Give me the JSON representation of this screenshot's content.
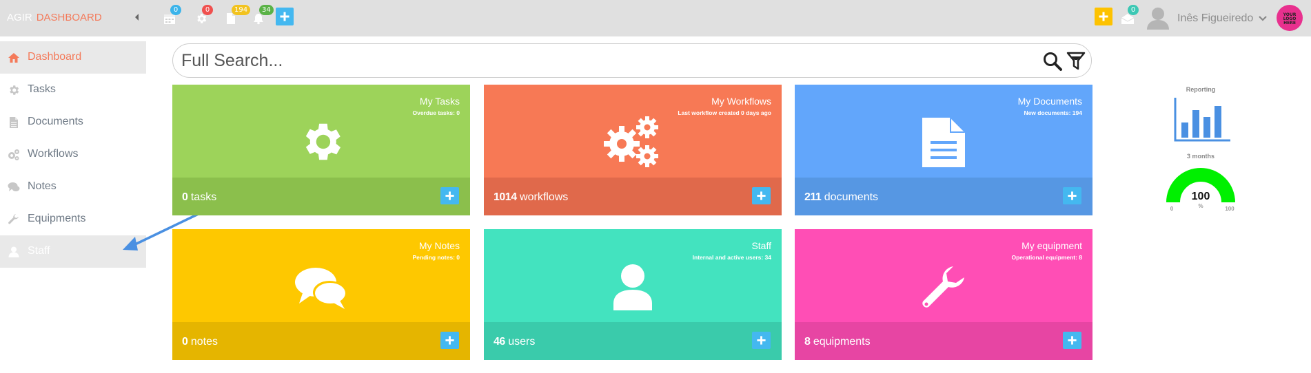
{
  "brand": {
    "part1": "AGIR",
    "part2": "DASHBOARD"
  },
  "topbar": {
    "badges": {
      "calendar": "0",
      "settings": "0",
      "documents": "194",
      "notifications": "34",
      "messages": "0"
    },
    "user_name": "Inês Figueiredo",
    "logo_text": [
      "YOUR",
      "LOGO",
      "HERE"
    ]
  },
  "sidebar": {
    "items": [
      {
        "label": "Dashboard",
        "icon": "home-icon"
      },
      {
        "label": "Tasks",
        "icon": "gear-icon"
      },
      {
        "label": "Documents",
        "icon": "document-icon"
      },
      {
        "label": "Workflows",
        "icon": "gears-icon"
      },
      {
        "label": "Notes",
        "icon": "comments-icon"
      },
      {
        "label": "Equipments",
        "icon": "wrench-icon"
      },
      {
        "label": "Staff",
        "icon": "user-icon"
      }
    ]
  },
  "search": {
    "placeholder": "Full Search..."
  },
  "tiles": [
    {
      "title": "My Tasks",
      "subtitle": "Overdue tasks: 0",
      "count": "0",
      "unit": "tasks",
      "icon": "gear-icon"
    },
    {
      "title": "My Workflows",
      "subtitle": "Last workflow created 0 days ago",
      "count": "1014",
      "unit": "workflows",
      "icon": "gears-icon"
    },
    {
      "title": "My Documents",
      "subtitle": "New documents: 194",
      "count": "211",
      "unit": "documents",
      "icon": "document-icon"
    },
    {
      "title": "My Notes",
      "subtitle": "Pending notes: 0",
      "count": "0",
      "unit": "notes",
      "icon": "comments-icon"
    },
    {
      "title": "Staff",
      "subtitle": "Internal and active users: 34",
      "count": "46",
      "unit": "users",
      "icon": "user-icon"
    },
    {
      "title": "My equipment",
      "subtitle": "Operational equipment: 8",
      "count": "8",
      "unit": "equipments",
      "icon": "wrench-icon"
    }
  ],
  "reporting": {
    "label": "Reporting",
    "period": "3 months",
    "gauge_value": "100",
    "gauge_unit": "%",
    "gauge_min": "0",
    "gauge_max": "100"
  },
  "colors": {
    "accent": "#f47a5a",
    "tasks": "#9dd35a",
    "tasks_foot": "#8bbf4c",
    "workflows": "#f77955",
    "workflows_foot": "#e0694b",
    "documents": "#62a6fb",
    "documents_foot": "#5697e3",
    "notes": "#fec800",
    "notes_foot": "#e5b500",
    "staff": "#43e3bf",
    "staff_foot": "#3acbab",
    "equipment": "#ff4eb5",
    "equipment_foot": "#e745a3",
    "add_button": "#44b8f0"
  }
}
